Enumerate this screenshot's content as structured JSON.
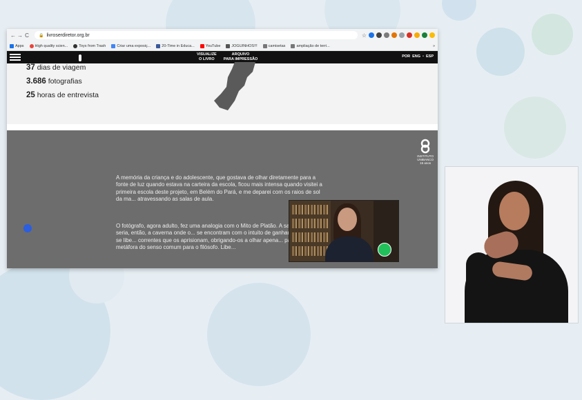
{
  "browser": {
    "url": "livroserdiretor.org.br",
    "bookmarks": [
      "Apps",
      "High quality scien...",
      "Toys from Trash",
      "Criar uma exposiç...",
      "20-Time in Educa...",
      "YouTube",
      "JOGUINHOS!!!",
      "camisetas",
      "ampliação de terri..."
    ],
    "more_bookmarks": "»"
  },
  "site": {
    "nav_visualize_line1": "VISUALIZE",
    "nav_visualize_line2": "O LIVRO",
    "nav_archive_line1": "ARQUIVO",
    "nav_archive_line2": "PARA IMPRESSÃO",
    "lang_por": "POR",
    "lang_eng": "ENG",
    "lang_esp": "ESP",
    "lang_sep": "•"
  },
  "stats": [
    {
      "number": "37",
      "label": "dias de viagem"
    },
    {
      "number": "3.686",
      "label": "fotografias"
    },
    {
      "number": "25",
      "label": "horas de entrevista"
    }
  ],
  "logo": {
    "line1": "INSTITUTO",
    "line2": "UNIBANCO",
    "line3": "15 anos"
  },
  "paragraphs": [
    "A memória da criança e do adolescente, que gostava de olhar diretamente para a fonte de luz quando estava na carteira da escola, ficou mais intensa quando visitei a primeira escola deste projeto, em Belém do Pará, e me deparei com os raios de sol da ma... atravessando as salas de aula.",
    "O fotógrafo, agora adulto, fez uma analogia com o Mito de Platão. A sala de aula seria, então, a caverna onde o... se encontram com o intuito de ganhar forças para se libe... correntes que os aprisionam, obrigando-os a olhar apena... parede — metáfora do senso comum para o filósofo. Libe..."
  ],
  "colors": {
    "accent_yellow": "#f5d21e",
    "header_bg": "#111111",
    "section_gray": "#6d6d6d",
    "mic_green": "#22c05a",
    "dot_blue": "#2b5ee0"
  }
}
